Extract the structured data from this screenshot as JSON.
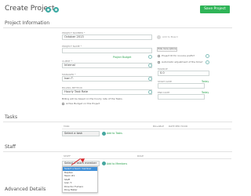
{
  "header": {
    "title": "Create Project",
    "save_label": "Save Project",
    "colors": {
      "accent": "#3aa9a2",
      "save": "#2fb457"
    }
  },
  "project_info": {
    "section_title": "Project Information",
    "project_number_label": "PROJECT NUMBER *",
    "project_number_value": "October 2013",
    "add_to_board_label": "Add to Board",
    "project_name_label": "PROJECT NAME *",
    "project_name_value": "",
    "project_budget_link": "Project Budget",
    "client_label": "CLIENT *",
    "client_value": "Internal",
    "manager_label": "MANAGER *",
    "manager_value": "Ivan T.",
    "billing_method_label": "BILLING METHOD",
    "billing_method_value": "Hourly Task Rate",
    "billing_note": "Billing will be based on the hourly rate of the Tasks.",
    "active_budget_label": "Active Budget on this Project",
    "side_panel": {
      "button": "Hide more options",
      "project_ids_label": "Project ID for invoice prefix?",
      "auto_adjust_label": "Automatic adjustment of the time?",
      "rate_label": "MARKUP",
      "rate_value": "0.0",
      "start_label": "START DATE",
      "start_link": "Today",
      "end_label": "END DATE",
      "end_link": "Today"
    }
  },
  "tasks": {
    "section_title": "Tasks",
    "col_task": "TASK",
    "col_billable": "BILLABLE",
    "col_rate": "RATE PER HOUR",
    "select_value": "Select a task",
    "add_link": "Add to Tasks"
  },
  "staff": {
    "section_title": "Staff",
    "col_staff": "STAFF",
    "col_role": "ROLE",
    "select_value": "Select a team member",
    "add_link": "Add to Members",
    "dropdown": [
      "Select a team member",
      "Replies",
      "Team #1",
      "Staff",
      "Ivan T.",
      "Director Fumero",
      "Ding Meter"
    ]
  },
  "advanced": {
    "section_title": "Advanced Details"
  }
}
